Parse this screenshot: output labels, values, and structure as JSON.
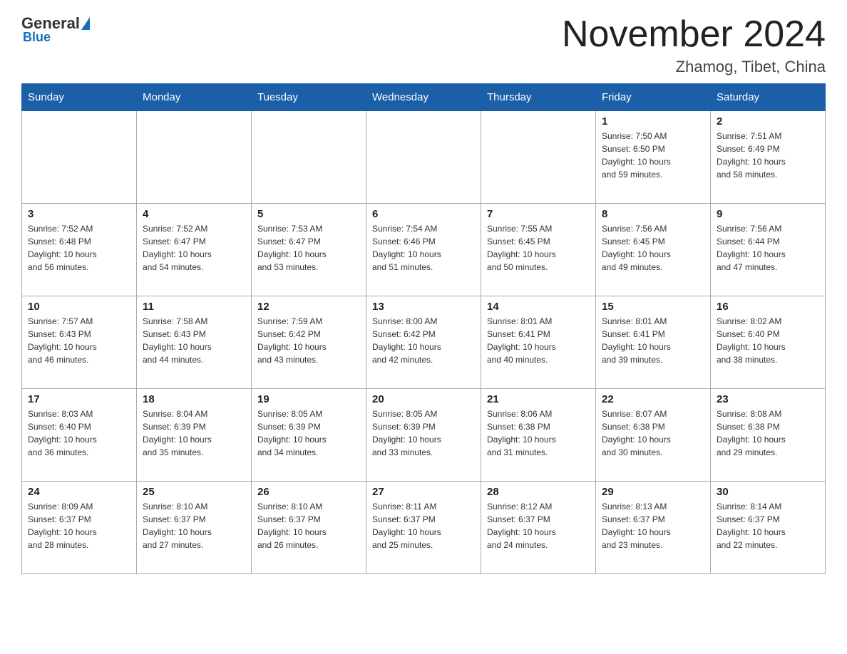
{
  "logo": {
    "general": "General",
    "blue": "Blue",
    "tagline": "Blue"
  },
  "title": {
    "month_year": "November 2024",
    "location": "Zhamog, Tibet, China"
  },
  "weekdays": [
    "Sunday",
    "Monday",
    "Tuesday",
    "Wednesday",
    "Thursday",
    "Friday",
    "Saturday"
  ],
  "weeks": [
    [
      {
        "day": "",
        "info": ""
      },
      {
        "day": "",
        "info": ""
      },
      {
        "day": "",
        "info": ""
      },
      {
        "day": "",
        "info": ""
      },
      {
        "day": "",
        "info": ""
      },
      {
        "day": "1",
        "info": "Sunrise: 7:50 AM\nSunset: 6:50 PM\nDaylight: 10 hours\nand 59 minutes."
      },
      {
        "day": "2",
        "info": "Sunrise: 7:51 AM\nSunset: 6:49 PM\nDaylight: 10 hours\nand 58 minutes."
      }
    ],
    [
      {
        "day": "3",
        "info": "Sunrise: 7:52 AM\nSunset: 6:48 PM\nDaylight: 10 hours\nand 56 minutes."
      },
      {
        "day": "4",
        "info": "Sunrise: 7:52 AM\nSunset: 6:47 PM\nDaylight: 10 hours\nand 54 minutes."
      },
      {
        "day": "5",
        "info": "Sunrise: 7:53 AM\nSunset: 6:47 PM\nDaylight: 10 hours\nand 53 minutes."
      },
      {
        "day": "6",
        "info": "Sunrise: 7:54 AM\nSunset: 6:46 PM\nDaylight: 10 hours\nand 51 minutes."
      },
      {
        "day": "7",
        "info": "Sunrise: 7:55 AM\nSunset: 6:45 PM\nDaylight: 10 hours\nand 50 minutes."
      },
      {
        "day": "8",
        "info": "Sunrise: 7:56 AM\nSunset: 6:45 PM\nDaylight: 10 hours\nand 49 minutes."
      },
      {
        "day": "9",
        "info": "Sunrise: 7:56 AM\nSunset: 6:44 PM\nDaylight: 10 hours\nand 47 minutes."
      }
    ],
    [
      {
        "day": "10",
        "info": "Sunrise: 7:57 AM\nSunset: 6:43 PM\nDaylight: 10 hours\nand 46 minutes."
      },
      {
        "day": "11",
        "info": "Sunrise: 7:58 AM\nSunset: 6:43 PM\nDaylight: 10 hours\nand 44 minutes."
      },
      {
        "day": "12",
        "info": "Sunrise: 7:59 AM\nSunset: 6:42 PM\nDaylight: 10 hours\nand 43 minutes."
      },
      {
        "day": "13",
        "info": "Sunrise: 8:00 AM\nSunset: 6:42 PM\nDaylight: 10 hours\nand 42 minutes."
      },
      {
        "day": "14",
        "info": "Sunrise: 8:01 AM\nSunset: 6:41 PM\nDaylight: 10 hours\nand 40 minutes."
      },
      {
        "day": "15",
        "info": "Sunrise: 8:01 AM\nSunset: 6:41 PM\nDaylight: 10 hours\nand 39 minutes."
      },
      {
        "day": "16",
        "info": "Sunrise: 8:02 AM\nSunset: 6:40 PM\nDaylight: 10 hours\nand 38 minutes."
      }
    ],
    [
      {
        "day": "17",
        "info": "Sunrise: 8:03 AM\nSunset: 6:40 PM\nDaylight: 10 hours\nand 36 minutes."
      },
      {
        "day": "18",
        "info": "Sunrise: 8:04 AM\nSunset: 6:39 PM\nDaylight: 10 hours\nand 35 minutes."
      },
      {
        "day": "19",
        "info": "Sunrise: 8:05 AM\nSunset: 6:39 PM\nDaylight: 10 hours\nand 34 minutes."
      },
      {
        "day": "20",
        "info": "Sunrise: 8:05 AM\nSunset: 6:39 PM\nDaylight: 10 hours\nand 33 minutes."
      },
      {
        "day": "21",
        "info": "Sunrise: 8:06 AM\nSunset: 6:38 PM\nDaylight: 10 hours\nand 31 minutes."
      },
      {
        "day": "22",
        "info": "Sunrise: 8:07 AM\nSunset: 6:38 PM\nDaylight: 10 hours\nand 30 minutes."
      },
      {
        "day": "23",
        "info": "Sunrise: 8:08 AM\nSunset: 6:38 PM\nDaylight: 10 hours\nand 29 minutes."
      }
    ],
    [
      {
        "day": "24",
        "info": "Sunrise: 8:09 AM\nSunset: 6:37 PM\nDaylight: 10 hours\nand 28 minutes."
      },
      {
        "day": "25",
        "info": "Sunrise: 8:10 AM\nSunset: 6:37 PM\nDaylight: 10 hours\nand 27 minutes."
      },
      {
        "day": "26",
        "info": "Sunrise: 8:10 AM\nSunset: 6:37 PM\nDaylight: 10 hours\nand 26 minutes."
      },
      {
        "day": "27",
        "info": "Sunrise: 8:11 AM\nSunset: 6:37 PM\nDaylight: 10 hours\nand 25 minutes."
      },
      {
        "day": "28",
        "info": "Sunrise: 8:12 AM\nSunset: 6:37 PM\nDaylight: 10 hours\nand 24 minutes."
      },
      {
        "day": "29",
        "info": "Sunrise: 8:13 AM\nSunset: 6:37 PM\nDaylight: 10 hours\nand 23 minutes."
      },
      {
        "day": "30",
        "info": "Sunrise: 8:14 AM\nSunset: 6:37 PM\nDaylight: 10 hours\nand 22 minutes."
      }
    ]
  ]
}
